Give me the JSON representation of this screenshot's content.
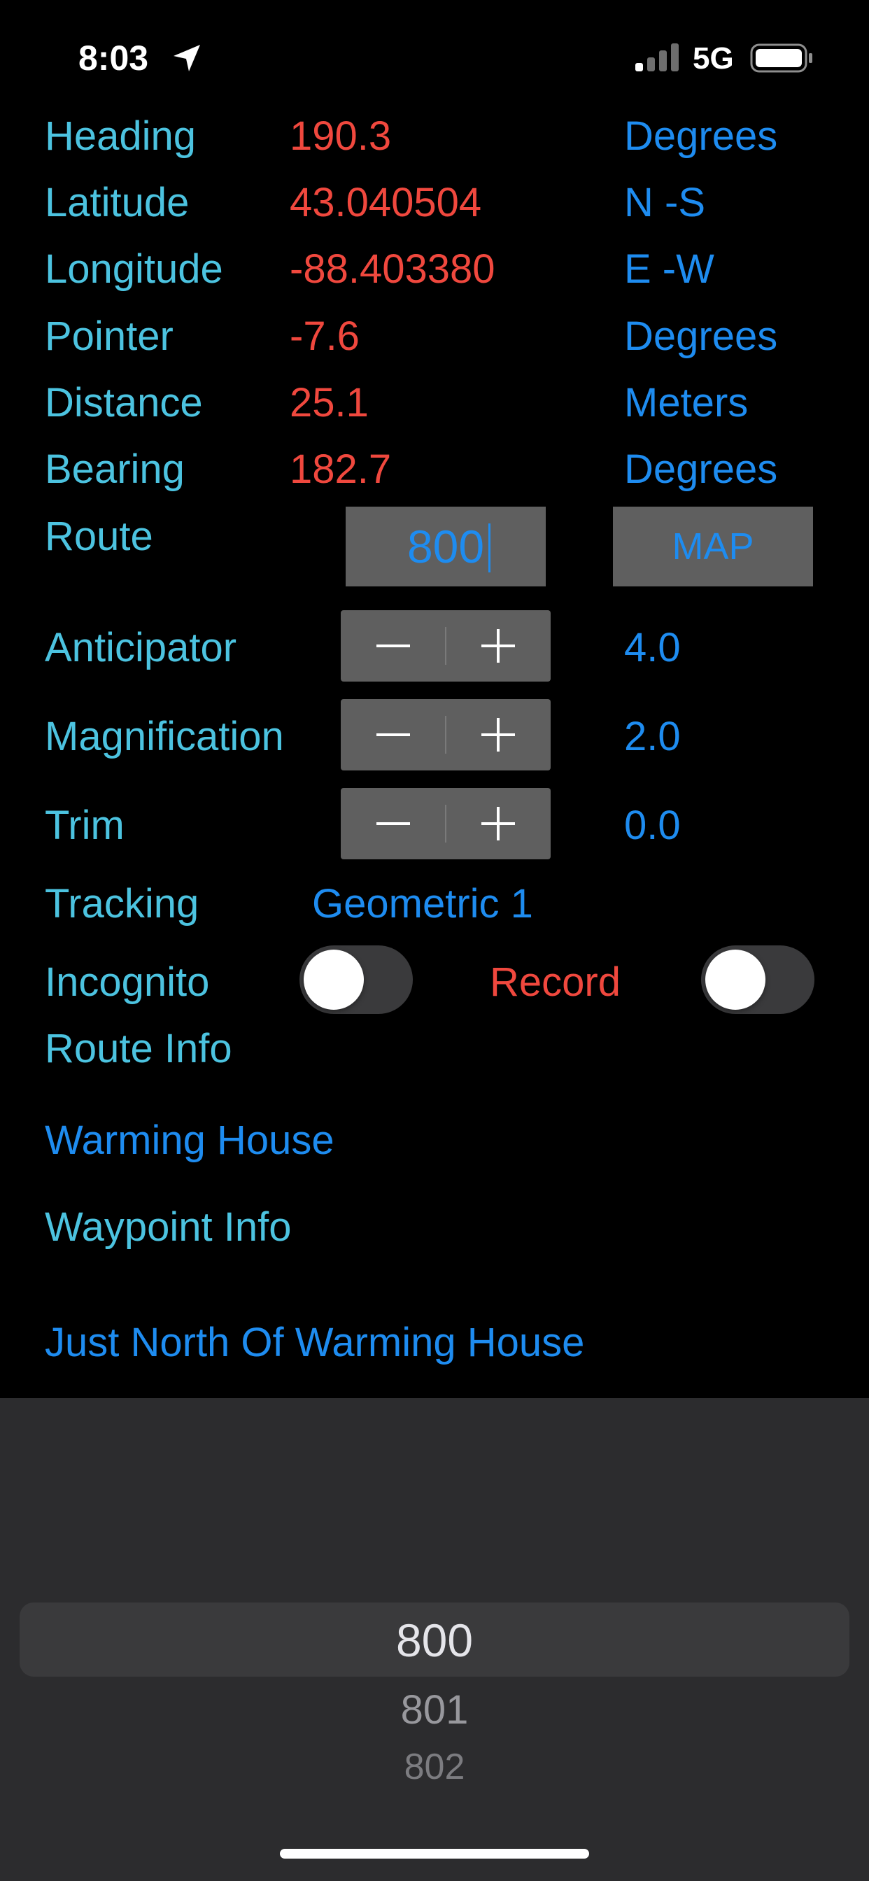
{
  "status_bar": {
    "time": "8:03",
    "network": "5G",
    "icons": [
      "location-arrow-icon",
      "cellular-signal-icon",
      "battery-icon"
    ]
  },
  "readouts": [
    {
      "label": "Heading",
      "value": "190.3",
      "unit": "Degrees"
    },
    {
      "label": "Latitude",
      "value": "43.040504",
      "unit": "N -S"
    },
    {
      "label": "Longitude",
      "value": "-88.403380",
      "unit": "E -W"
    },
    {
      "label": "Pointer",
      "value": "-7.6",
      "unit": "Degrees"
    },
    {
      "label": "Distance",
      "value": "25.1",
      "unit": "Meters"
    },
    {
      "label": "Bearing",
      "value": "182.7",
      "unit": "Degrees"
    }
  ],
  "route": {
    "label": "Route",
    "value": "800",
    "map_button": "MAP"
  },
  "steppers": [
    {
      "label": "Anticipator",
      "value": "4.0"
    },
    {
      "label": "Magnification",
      "value": "2.0"
    },
    {
      "label": "Trim",
      "value": "0.0"
    }
  ],
  "tracking": {
    "label": "Tracking",
    "value": "Geometric 1"
  },
  "toggles": {
    "incognito_label": "Incognito",
    "incognito_on": false,
    "record_label": "Record",
    "record_on": false
  },
  "route_info": {
    "label": "Route Info",
    "value": "Warming House"
  },
  "waypoint_info": {
    "label": "Waypoint Info",
    "value": "Just North Of Warming House"
  },
  "picker": {
    "selected": "800",
    "next": [
      "801",
      "802"
    ]
  },
  "colors": {
    "label": "#4CC3E0",
    "value": "#F0483E",
    "accent": "#1E8CF0",
    "control_gray": "#5F5F5F",
    "picker_bg": "#2C2C2E"
  }
}
